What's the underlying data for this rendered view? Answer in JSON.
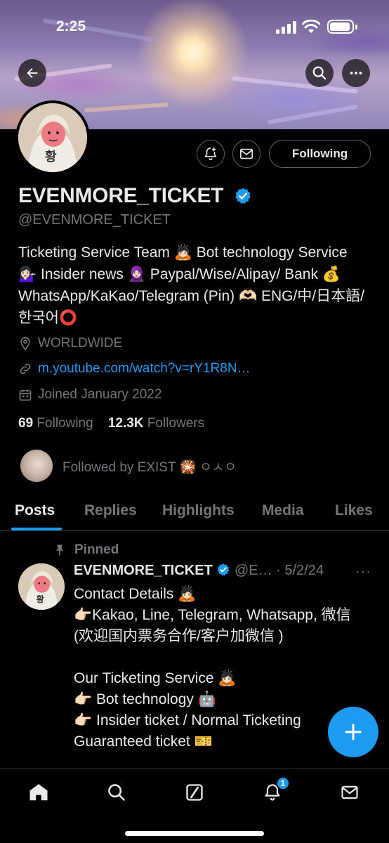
{
  "status": {
    "time": "2:25"
  },
  "profile": {
    "name": "EVENMORE_TICKET",
    "handle": "@EVENMORE_TICKET",
    "bio": "Ticketing Service Team 🙇🏻 Bot technology Service 💁🏻‍♀️ Insider news 🧕🏻 Paypal/Wise/Alipay/ Bank 💰 WhatsApp/KaKao/Telegram (Pin) 🫶🏻 ENG/中/日本語/한국어⭕",
    "location": "WORLDWIDE",
    "link": "m.youtube.com/watch?v=rY1R8N…",
    "joined": "Joined January 2022",
    "following_count": "69",
    "following_label": "Following",
    "followers_count": "12.3K",
    "followers_label": "Followers",
    "followed_by": "Followed by EXIST 🎇 ㅇㅅㅇ",
    "following_button": "Following"
  },
  "tabs": [
    {
      "label": "Posts",
      "active": true
    },
    {
      "label": "Replies",
      "active": false
    },
    {
      "label": "Highlights",
      "active": false
    },
    {
      "label": "Media",
      "active": false
    },
    {
      "label": "Likes",
      "active": false
    }
  ],
  "post": {
    "pinned_label": "Pinned",
    "name": "EVENMORE_TICKET",
    "handle_date": "@E… · 5/2/24",
    "more": "···",
    "body": "Contact Details 🙇🏻\n👉🏻Kakao, Line, Telegram, Whatsapp, 微信 (欢迎国内票务合作/客户加微信 )\n\nOur Ticketing Service 🙇🏻\n👉🏻 Bot technology 🤖\n👉🏻 Insider ticket / Normal Ticketing\nGuaranteed ticket 🎫"
  },
  "nav": {
    "notifications_badge": "1"
  },
  "colors": {
    "accent": "#1d9bf0",
    "muted": "#71767b",
    "text": "#e7e9ea",
    "border": "#2f3336"
  },
  "icons": [
    "back-arrow-icon",
    "search-icon",
    "more-icon",
    "notification-bell-plus-icon",
    "message-icon",
    "verified-badge-icon",
    "location-icon",
    "link-icon",
    "calendar-icon",
    "pin-icon",
    "plus-icon",
    "home-icon",
    "compose-icon",
    "bell-icon",
    "mail-icon"
  ]
}
